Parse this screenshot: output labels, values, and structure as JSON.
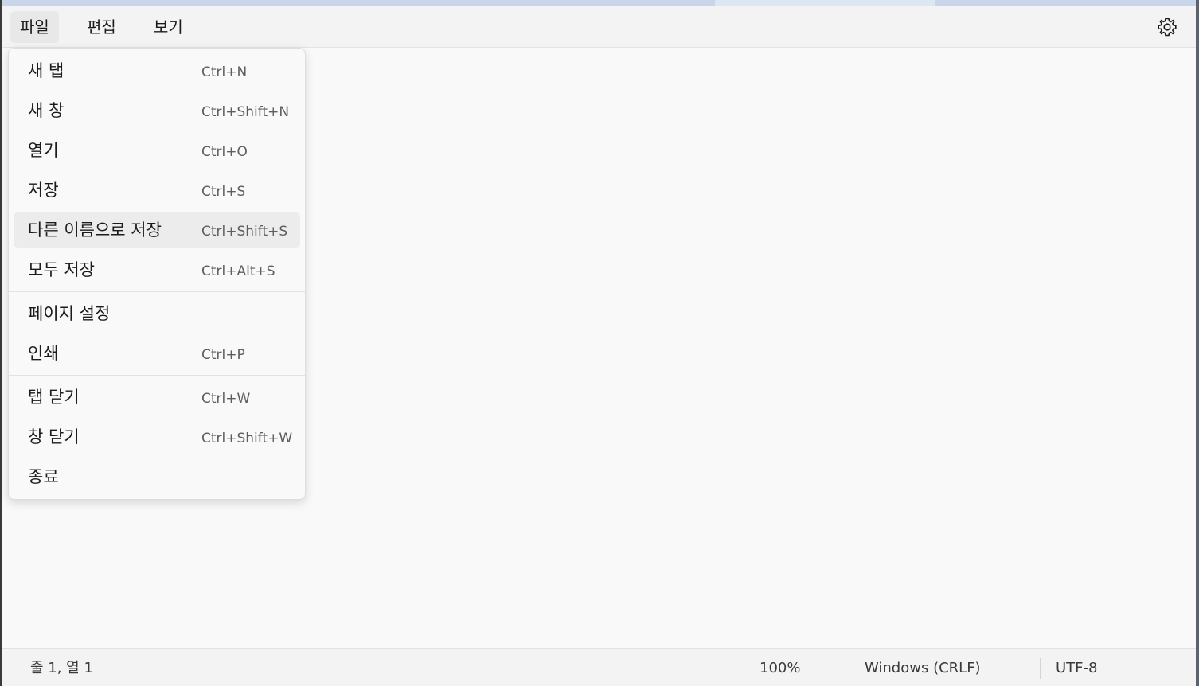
{
  "menubar": {
    "items": [
      {
        "label": "파일",
        "active": true
      },
      {
        "label": "편집",
        "active": false
      },
      {
        "label": "보기",
        "active": false
      }
    ],
    "settings_icon": "gear-icon"
  },
  "file_menu": {
    "items": [
      {
        "label": "새 탭",
        "shortcut": "Ctrl+N"
      },
      {
        "label": "새 창",
        "shortcut": "Ctrl+Shift+N"
      },
      {
        "label": "열기",
        "shortcut": "Ctrl+O"
      },
      {
        "label": "저장",
        "shortcut": "Ctrl+S"
      },
      {
        "label": "다른 이름으로 저장",
        "shortcut": "Ctrl+Shift+S",
        "hovered": true
      },
      {
        "label": "모두 저장",
        "shortcut": "Ctrl+Alt+S"
      },
      {
        "label": "페이지 설정",
        "shortcut": ""
      },
      {
        "label": "인쇄",
        "shortcut": "Ctrl+P"
      },
      {
        "label": "탭 닫기",
        "shortcut": "Ctrl+W"
      },
      {
        "label": "창 닫기",
        "shortcut": "Ctrl+Shift+W"
      },
      {
        "label": "종료",
        "shortcut": ""
      }
    ]
  },
  "statusbar": {
    "position": "줄 1, 열 1",
    "zoom": "100%",
    "line_ending": "Windows (CRLF)",
    "encoding": "UTF-8"
  },
  "colors": {
    "menu_hover": "#ececec",
    "background": "#f9f9f9"
  }
}
